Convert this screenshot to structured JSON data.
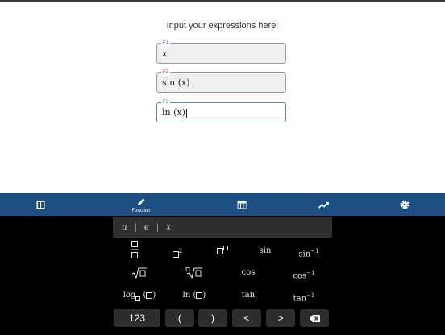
{
  "prompt": "Input your expressions here:",
  "functions": [
    {
      "tag": "F1",
      "expr": "x",
      "tag_color": "#8e44ad"
    },
    {
      "tag": "F2",
      "expr": "sin (x)",
      "tag_color": "#d03030"
    },
    {
      "tag": "F3",
      "expr": "ln (x)",
      "tag_color": "#2e8b3a"
    }
  ],
  "toolbar": {
    "items": [
      {
        "icon": "calculator-grid-icon"
      },
      {
        "icon": "pencil-icon",
        "label": "Function"
      },
      {
        "icon": "table-icon"
      },
      {
        "icon": "trend-chart-icon"
      },
      {
        "icon": "gear-icon"
      }
    ],
    "color": "#1d4f82"
  },
  "keyboard": {
    "constants": [
      "π",
      "e",
      "x"
    ],
    "keys": {
      "square": "2",
      "sin": "sin",
      "arcsin": "sin",
      "cos": "cos",
      "arccos": "cos",
      "tan": "tan",
      "arctan": "tan",
      "inverse_exp": "−1",
      "log": "log",
      "ln": "ln"
    },
    "nav": {
      "abc": "123",
      "lparen": "(",
      "rparen": ")",
      "left": "<",
      "right": ">"
    }
  }
}
